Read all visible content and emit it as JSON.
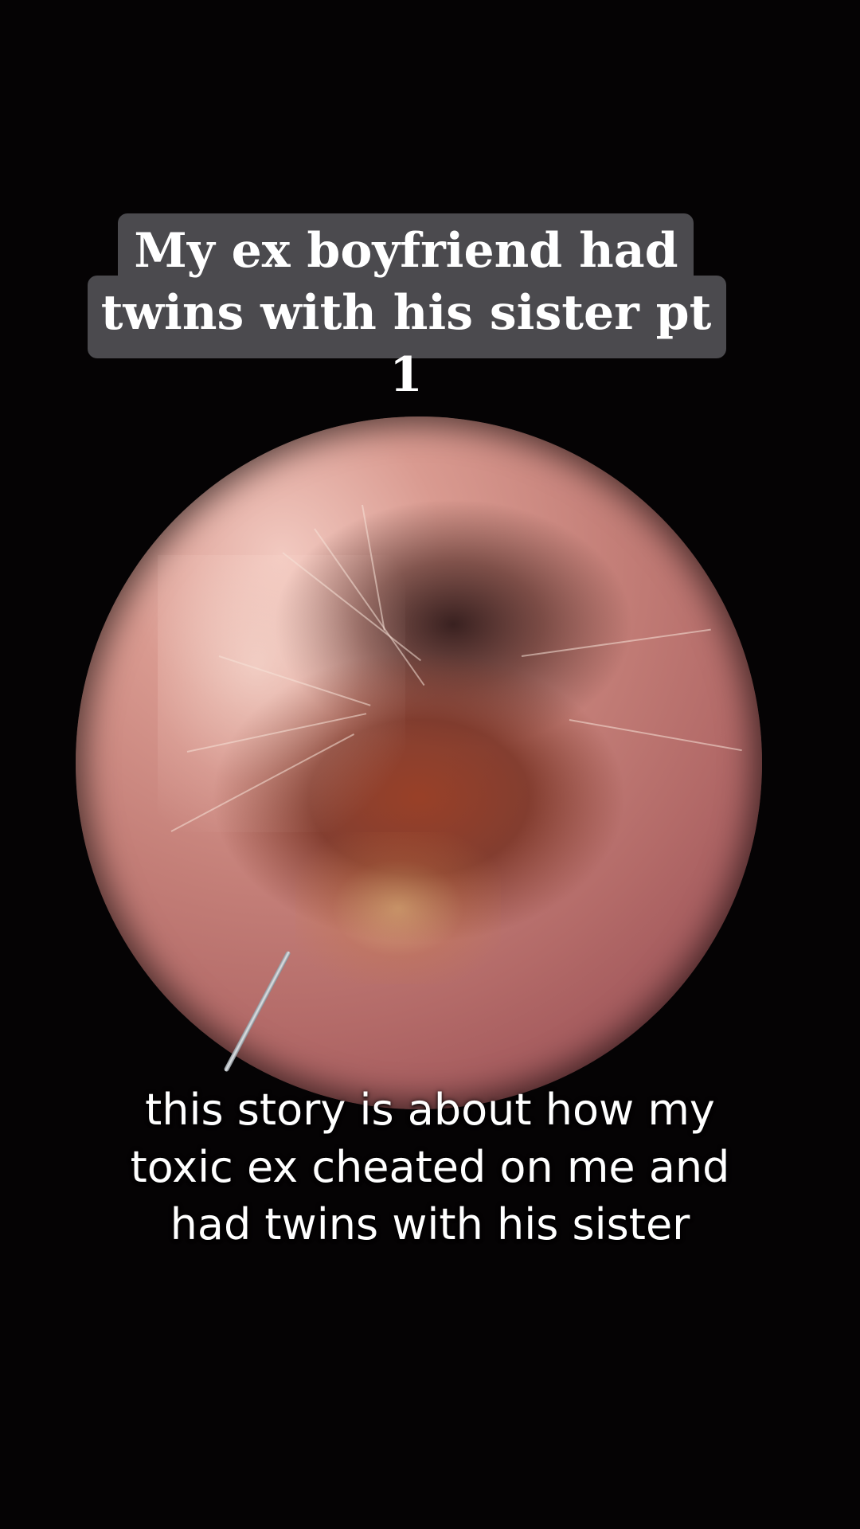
{
  "video": {
    "title_lines": [
      "My ex boyfriend had",
      "twins with his sister pt 1"
    ],
    "caption_lines": [
      "this story is about how my",
      "toxic ex cheated on me and",
      "had twins with his sister"
    ],
    "colors": {
      "background": "#000000",
      "title_box": "#4b4a4e",
      "text": "#ffffff"
    }
  }
}
